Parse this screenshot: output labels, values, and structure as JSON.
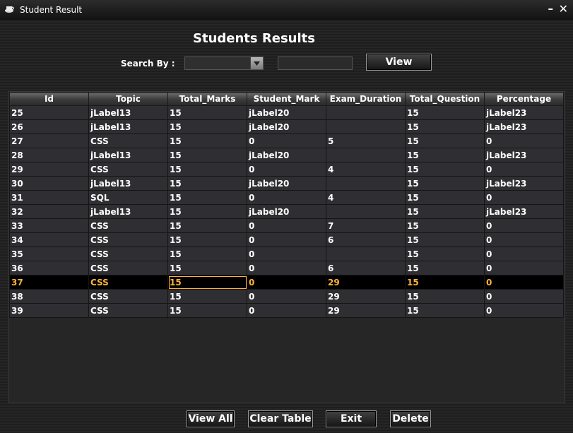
{
  "window": {
    "title": "Student Result",
    "minimize": "–",
    "close": "✕"
  },
  "heading": "Students Results",
  "search": {
    "label": "Search By :",
    "combo_value": "",
    "field_value": ""
  },
  "buttons": {
    "view": "View",
    "view_all": "View All",
    "clear_table": "Clear Table",
    "exit": "Exit",
    "delete": "Delete"
  },
  "table": {
    "columns": [
      "Id",
      "Topic",
      "Total_Marks",
      "Student_Mark",
      "Exam_Duration",
      "Total_Question",
      "Percentage"
    ],
    "selected_row_index": 12,
    "rows": [
      [
        "25",
        "jLabel13",
        "15",
        "jLabel20",
        "",
        "15",
        "jLabel23"
      ],
      [
        "26",
        "jLabel13",
        "15",
        "jLabel20",
        "",
        "15",
        "jLabel23"
      ],
      [
        "27",
        "CSS",
        "15",
        "0",
        "5",
        "15",
        "0"
      ],
      [
        "28",
        "jLabel13",
        "15",
        "jLabel20",
        "",
        "15",
        "jLabel23"
      ],
      [
        "29",
        "CSS",
        "15",
        "0",
        "4",
        "15",
        "0"
      ],
      [
        "30",
        "jLabel13",
        "15",
        "jLabel20",
        "",
        "15",
        "jLabel23"
      ],
      [
        "31",
        "SQL",
        "15",
        "0",
        "4",
        "15",
        "0"
      ],
      [
        "32",
        "jLabel13",
        "15",
        "jLabel20",
        "",
        "15",
        "jLabel23"
      ],
      [
        "33",
        "CSS",
        "15",
        "0",
        "7",
        "15",
        "0"
      ],
      [
        "34",
        "CSS",
        "15",
        "0",
        "6",
        "15",
        "0"
      ],
      [
        "35",
        "CSS",
        "15",
        "0",
        "",
        "15",
        "0"
      ],
      [
        "36",
        "CSS",
        "15",
        "0",
        "6",
        "15",
        "0"
      ],
      [
        "37",
        "CSS",
        "15",
        "0",
        "29",
        "15",
        "0"
      ],
      [
        "38",
        "CSS",
        "15",
        "0",
        "29",
        "15",
        "0"
      ],
      [
        "39",
        "CSS",
        "15",
        "0",
        "29",
        "15",
        "0"
      ]
    ]
  }
}
